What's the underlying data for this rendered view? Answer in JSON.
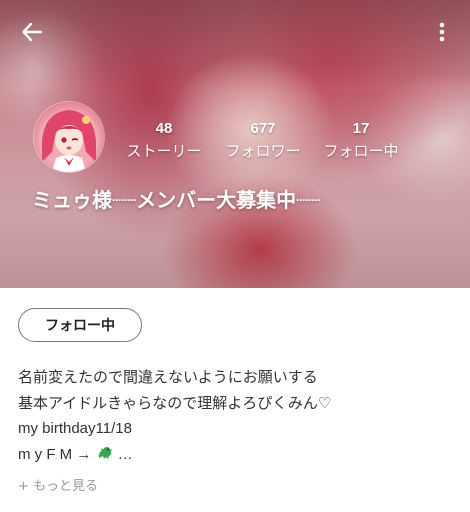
{
  "profile": {
    "name": "ミュゥ様┈┈メンバー大募集中┈┈",
    "stats": [
      {
        "value": "48",
        "label": "ストーリー"
      },
      {
        "value": "677",
        "label": "フォロワー"
      },
      {
        "value": "17",
        "label": "フォロー中"
      }
    ]
  },
  "actions": {
    "follow_label": "フォロー中"
  },
  "bio": {
    "line1": "名前変えたので間違えないようにお願いする",
    "line2": "基本アイドルきゃらなので理解よろぴくみん♡",
    "line3": "my birthday11/18",
    "line4_prefix": "m y F M → ",
    "line4_suffix": " …",
    "more_label": "+ もっと見る"
  },
  "icons": {
    "back": "arrow-left-icon",
    "more": "more-vertical-icon",
    "dragon": "dragon-emoji-icon"
  },
  "colors": {
    "header_tint": "#d99aa3",
    "text_primary": "#333333",
    "text_muted": "#999999",
    "button_border": "#7a7a7a"
  }
}
